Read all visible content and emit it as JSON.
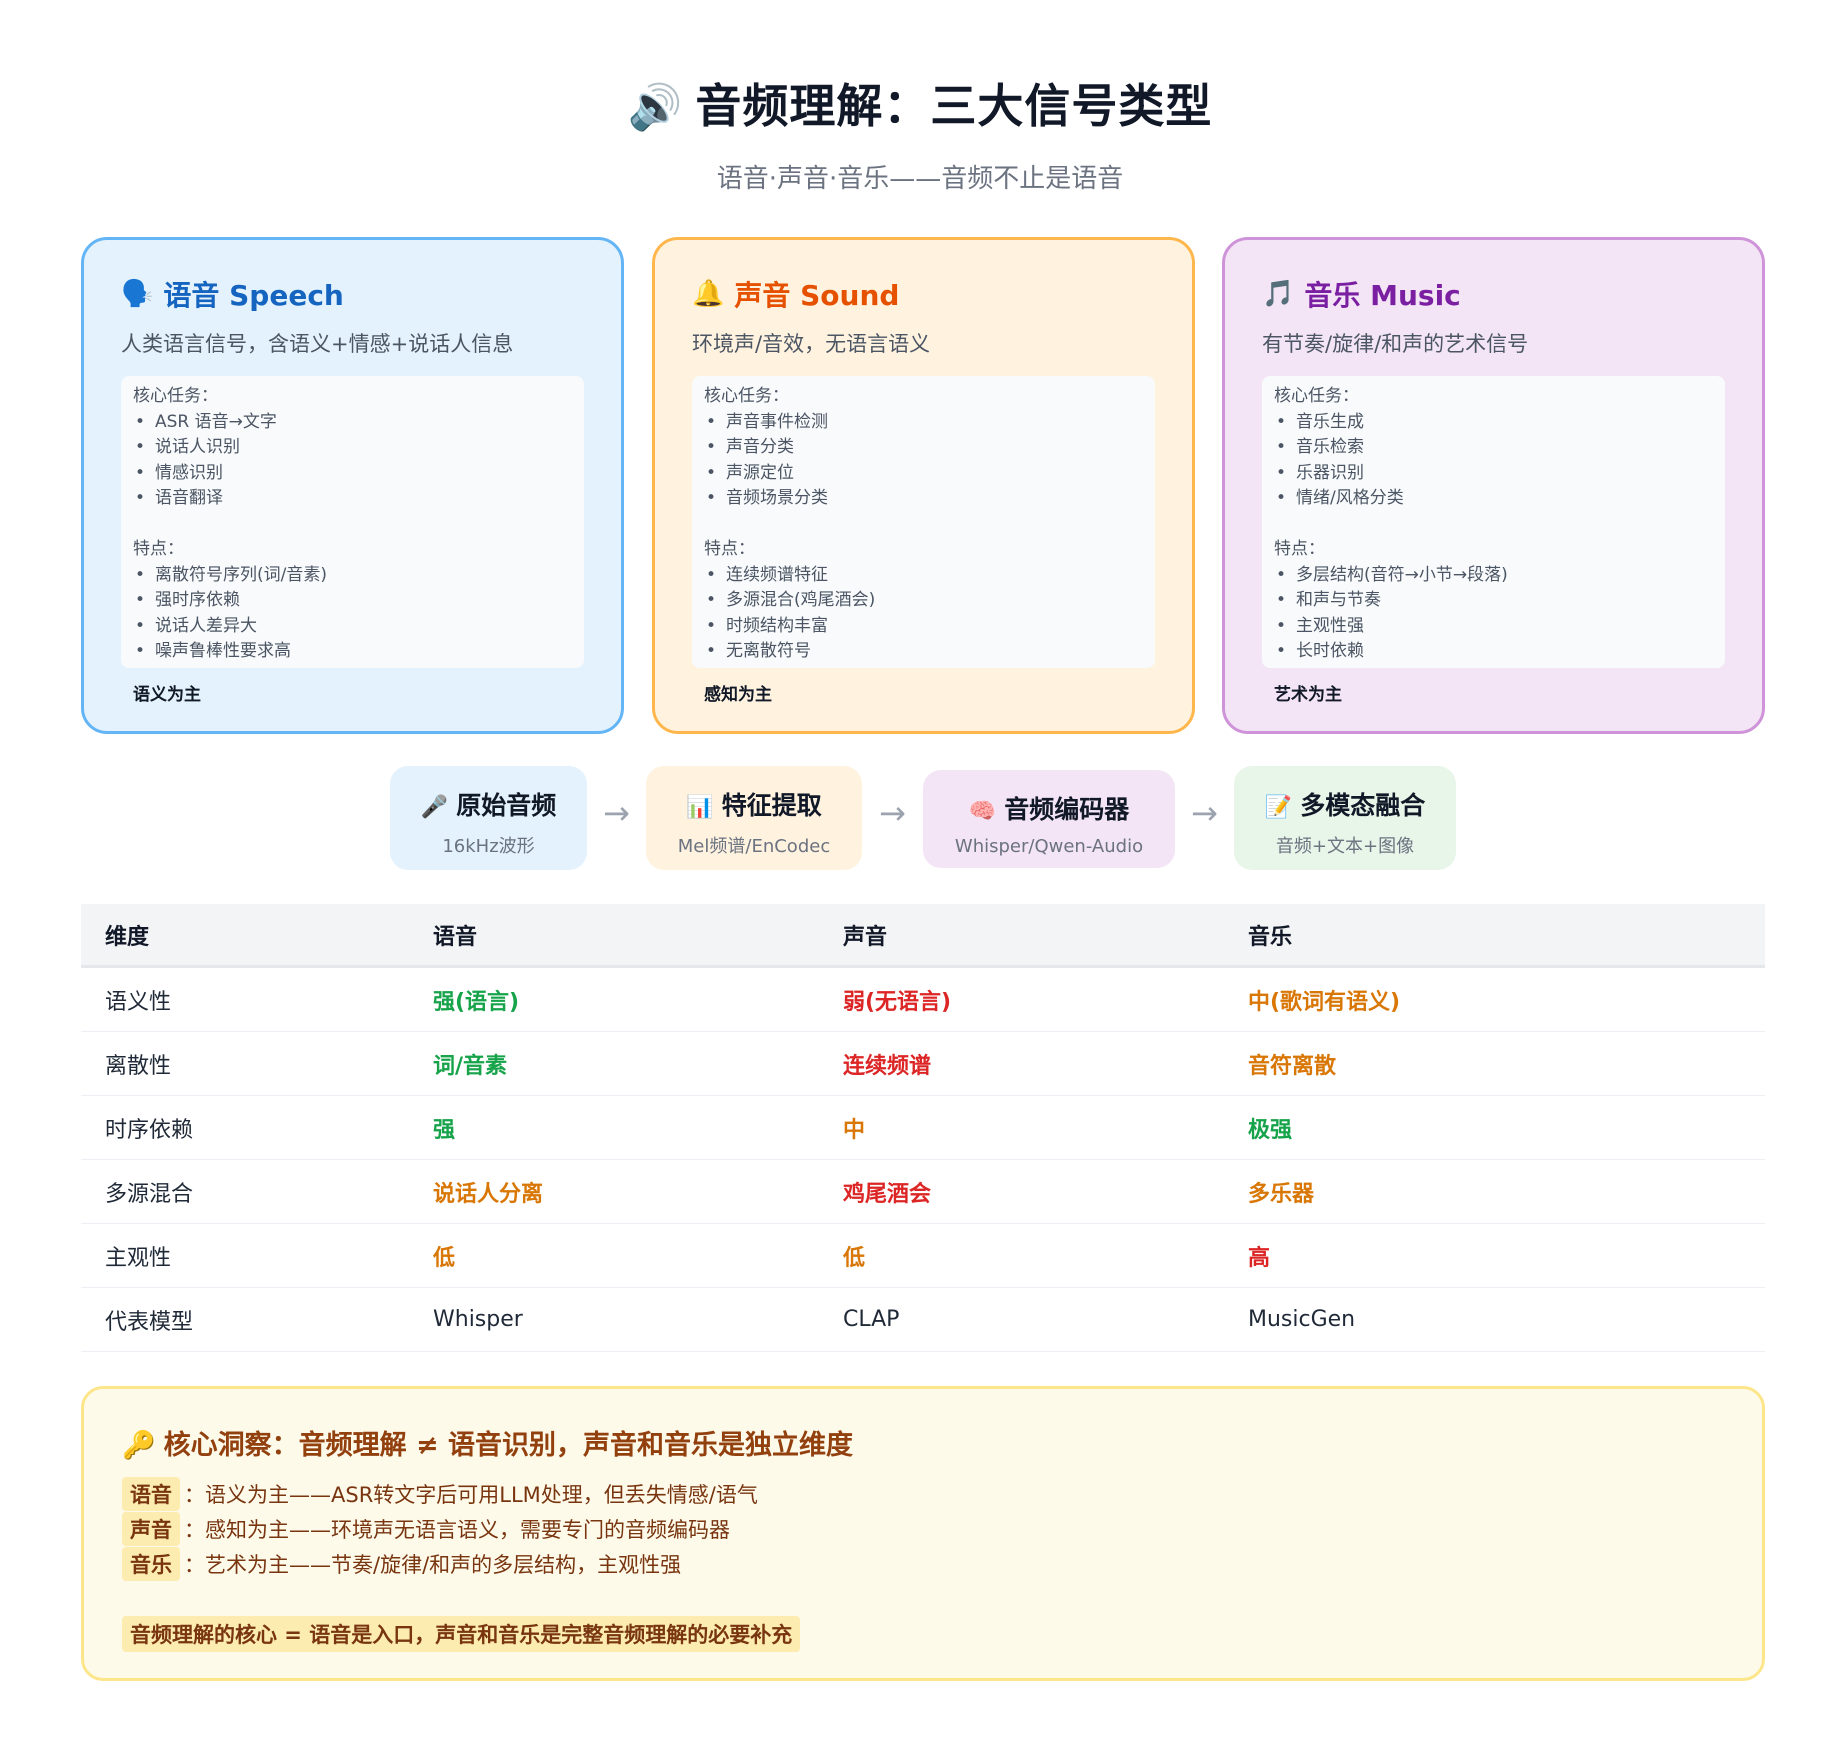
{
  "header": {
    "icon": "🔊",
    "title": "音频理解：三大信号类型",
    "subtitle": "语音·声音·音乐——音频不止是语音"
  },
  "cards": [
    {
      "icon": "🗣️",
      "title": "语音 Speech",
      "desc": "人类语言信号，含语义+情感+说话人信息",
      "tasks_label": "核心任务：",
      "tasks": [
        "ASR 语音→文字",
        "说话人识别",
        "情感识别",
        "语音翻译"
      ],
      "features_label": "特点：",
      "features": [
        "离散符号序列(词/音素)",
        "强时序依赖",
        "说话人差异大",
        "噪声鲁棒性要求高"
      ],
      "footer": "语义为主",
      "color": "#1565c0",
      "bg": "#e3f2fd",
      "border": "#64b5f6"
    },
    {
      "icon": "🔔",
      "title": "声音 Sound",
      "desc": "环境声/音效，无语言语义",
      "tasks_label": "核心任务：",
      "tasks": [
        "声音事件检测",
        "声音分类",
        "声源定位",
        "音频场景分类"
      ],
      "features_label": "特点：",
      "features": [
        "连续频谱特征",
        "多源混合(鸡尾酒会)",
        "时频结构丰富",
        "无离散符号"
      ],
      "footer": "感知为主",
      "color": "#e65100",
      "bg": "#fff3e0",
      "border": "#ffb74d"
    },
    {
      "icon": "🎵",
      "title": "音乐 Music",
      "desc": "有节奏/旋律/和声的艺术信号",
      "tasks_label": "核心任务：",
      "tasks": [
        "音乐生成",
        "音乐检索",
        "乐器识别",
        "情绪/风格分类"
      ],
      "features_label": "特点：",
      "features": [
        "多层结构(音符→小节→段落)",
        "和声与节奏",
        "主观性强",
        "长时依赖"
      ],
      "footer": "艺术为主",
      "color": "#7b1fa2",
      "bg": "#f3e5f5",
      "border": "#ce93d8"
    }
  ],
  "flow": [
    {
      "icon": "🎤",
      "title": "原始音频",
      "sub": "16kHz波形",
      "bg": "#e3f2fd"
    },
    {
      "icon": "📊",
      "title": "特征提取",
      "sub": "Mel频谱/EnCodec",
      "bg": "#fff3e0"
    },
    {
      "icon": "🧠",
      "title": "音频编码器",
      "sub": "Whisper/Qwen-Audio",
      "bg": "#f3e5f5"
    },
    {
      "icon": "📝",
      "title": "多模态融合",
      "sub": "音频+文本+图像",
      "bg": "#e8f5e9"
    }
  ],
  "flow_arrow": "→",
  "table": {
    "headers": [
      "维度",
      "语音",
      "声音",
      "音乐"
    ],
    "rows": [
      [
        "语义性",
        "强(语言)",
        "弱(无语言)",
        "中(歌词有语义)"
      ],
      [
        "离散性",
        "词/音素",
        "连续频谱",
        "音符离散"
      ],
      [
        "时序依赖",
        "强",
        "中",
        "极强"
      ],
      [
        "多源混合",
        "说话人分离",
        "鸡尾酒会",
        "多乐器"
      ],
      [
        "主观性",
        "低",
        "低",
        "高"
      ],
      [
        "代表模型",
        "Whisper",
        "CLAP",
        "MusicGen"
      ]
    ],
    "colors": {
      "green": "#16a34a",
      "red": "#dc2626",
      "orange": "#d97706"
    }
  },
  "insight": {
    "icon": "🔑",
    "title": "核心洞察：音频理解 ≠ 语音识别，声音和音乐是独立维度",
    "lines": [
      {
        "tag": "语音",
        "text": "：语义为主——ASR转文字后可用LLM处理，但丢失情感/语气"
      },
      {
        "tag": "声音",
        "text": "：感知为主——环境声无语言语义，需要专门的音频编码器"
      },
      {
        "tag": "音乐",
        "text": "：艺术为主——节奏/旋律/和声的多层结构，主观性强"
      }
    ],
    "conclusion": "音频理解的核心 = 语音是入口，声音和音乐是完整音频理解的必要补充"
  }
}
